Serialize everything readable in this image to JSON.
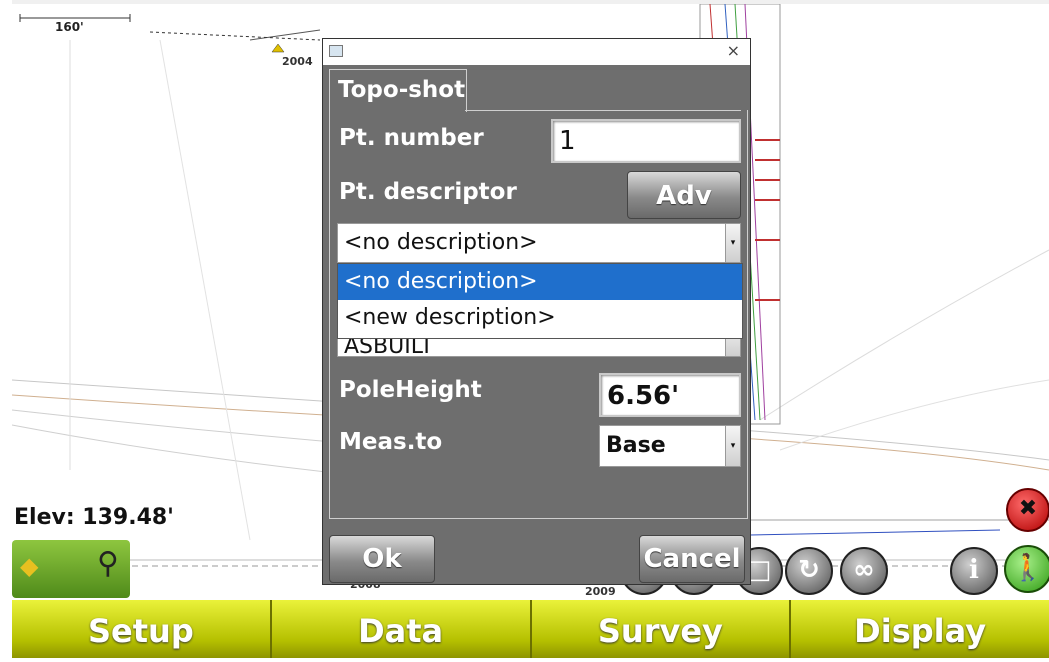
{
  "map": {
    "scale_label": "160'",
    "point_labels": [
      "2004",
      "2008",
      "2009"
    ],
    "elevation": "Elev: 139.48'"
  },
  "dialog": {
    "tab": "Topo-shot",
    "pt_number_label": "Pt. number",
    "pt_number_value": "1",
    "pt_descriptor_label": "Pt. descriptor",
    "adv_button": "Adv",
    "descriptor_selected": "<no description>",
    "descriptor_options": [
      "<no description>",
      "<new description>"
    ],
    "hidden_field_value": "ASBUILT",
    "pole_height_label": "PoleHeight",
    "pole_height_value": "6.56'",
    "meas_to_label": "Meas.to",
    "meas_to_value": "Base",
    "ok_button": "Ok",
    "cancel_button": "Cancel",
    "close_glyph": "×"
  },
  "menu": {
    "setup": "Setup",
    "data": "Data",
    "survey": "Survey",
    "display": "Display"
  },
  "icons": {
    "info": "i",
    "repeat": "∞"
  },
  "colors": {
    "menu_yellow": "#d3dc10",
    "dialog_gray": "#6e6e6e",
    "selection_blue": "#1f6fcc"
  }
}
